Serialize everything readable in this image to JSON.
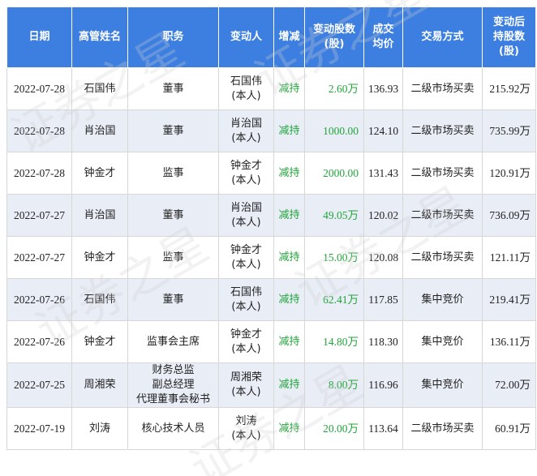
{
  "headers": {
    "date": "日期",
    "name": "高管姓名",
    "position": "职务",
    "changer": "变动人",
    "direction": "增减",
    "shares_l1": "变动股数",
    "shares_l2": "(股)",
    "price_l1": "成交",
    "price_l2": "均价",
    "method": "交易方式",
    "after_l1": "变动后",
    "after_l2": "持股数",
    "after_l3": "(股)"
  },
  "rows": [
    {
      "date": "2022-07-28",
      "name": "石国伟",
      "position": [
        "董事"
      ],
      "changer": "石国伟",
      "relation": "(本人)",
      "direction": "减持",
      "shares": "2.60万",
      "price": "136.93",
      "method": "二级市场买卖",
      "after": "215.92万"
    },
    {
      "date": "2022-07-28",
      "name": "肖治国",
      "position": [
        "董事"
      ],
      "changer": "肖治国",
      "relation": "(本人)",
      "direction": "减持",
      "shares": "1000.00",
      "price": "124.10",
      "method": "二级市场买卖",
      "after": "735.99万"
    },
    {
      "date": "2022-07-28",
      "name": "钟金才",
      "position": [
        "监事"
      ],
      "changer": "钟金才",
      "relation": "(本人)",
      "direction": "减持",
      "shares": "2000.00",
      "price": "131.43",
      "method": "二级市场买卖",
      "after": "120.91万"
    },
    {
      "date": "2022-07-27",
      "name": "肖治国",
      "position": [
        "董事"
      ],
      "changer": "肖治国",
      "relation": "(本人)",
      "direction": "减持",
      "shares": "49.05万",
      "price": "120.02",
      "method": "二级市场买卖",
      "after": "736.09万"
    },
    {
      "date": "2022-07-27",
      "name": "钟金才",
      "position": [
        "监事"
      ],
      "changer": "钟金才",
      "relation": "(本人)",
      "direction": "减持",
      "shares": "15.00万",
      "price": "120.08",
      "method": "二级市场买卖",
      "after": "121.11万"
    },
    {
      "date": "2022-07-26",
      "name": "石国伟",
      "position": [
        "董事"
      ],
      "changer": "石国伟",
      "relation": "(本人)",
      "direction": "减持",
      "shares": "62.41万",
      "price": "117.85",
      "method": "集中竞价",
      "after": "219.41万"
    },
    {
      "date": "2022-07-26",
      "name": "钟金才",
      "position": [
        "监事会主席"
      ],
      "changer": "钟金才",
      "relation": "(本人)",
      "direction": "减持",
      "shares": "14.80万",
      "price": "118.30",
      "method": "集中竞价",
      "after": "136.11万"
    },
    {
      "date": "2022-07-25",
      "name": "周湘荣",
      "position": [
        "财务总监",
        "副总经理",
        "代理董事会秘书"
      ],
      "changer": "周湘荣",
      "relation": "(本人)",
      "direction": "减持",
      "shares": "8.00万",
      "price": "116.96",
      "method": "集中竞价",
      "after": "72.00万"
    },
    {
      "date": "2022-07-19",
      "name": "刘涛",
      "position": [
        "核心技术人员"
      ],
      "changer": "刘涛",
      "relation": "(本人)",
      "direction": "减持",
      "shares": "20.00万",
      "price": "113.64",
      "method": "二级市场买卖",
      "after": "60.91万"
    }
  ],
  "colors": {
    "header_bg": "#3d7fe0",
    "stripe": "#e8edf6",
    "reduce": "#22a53a"
  },
  "watermark_text": "证券之星"
}
